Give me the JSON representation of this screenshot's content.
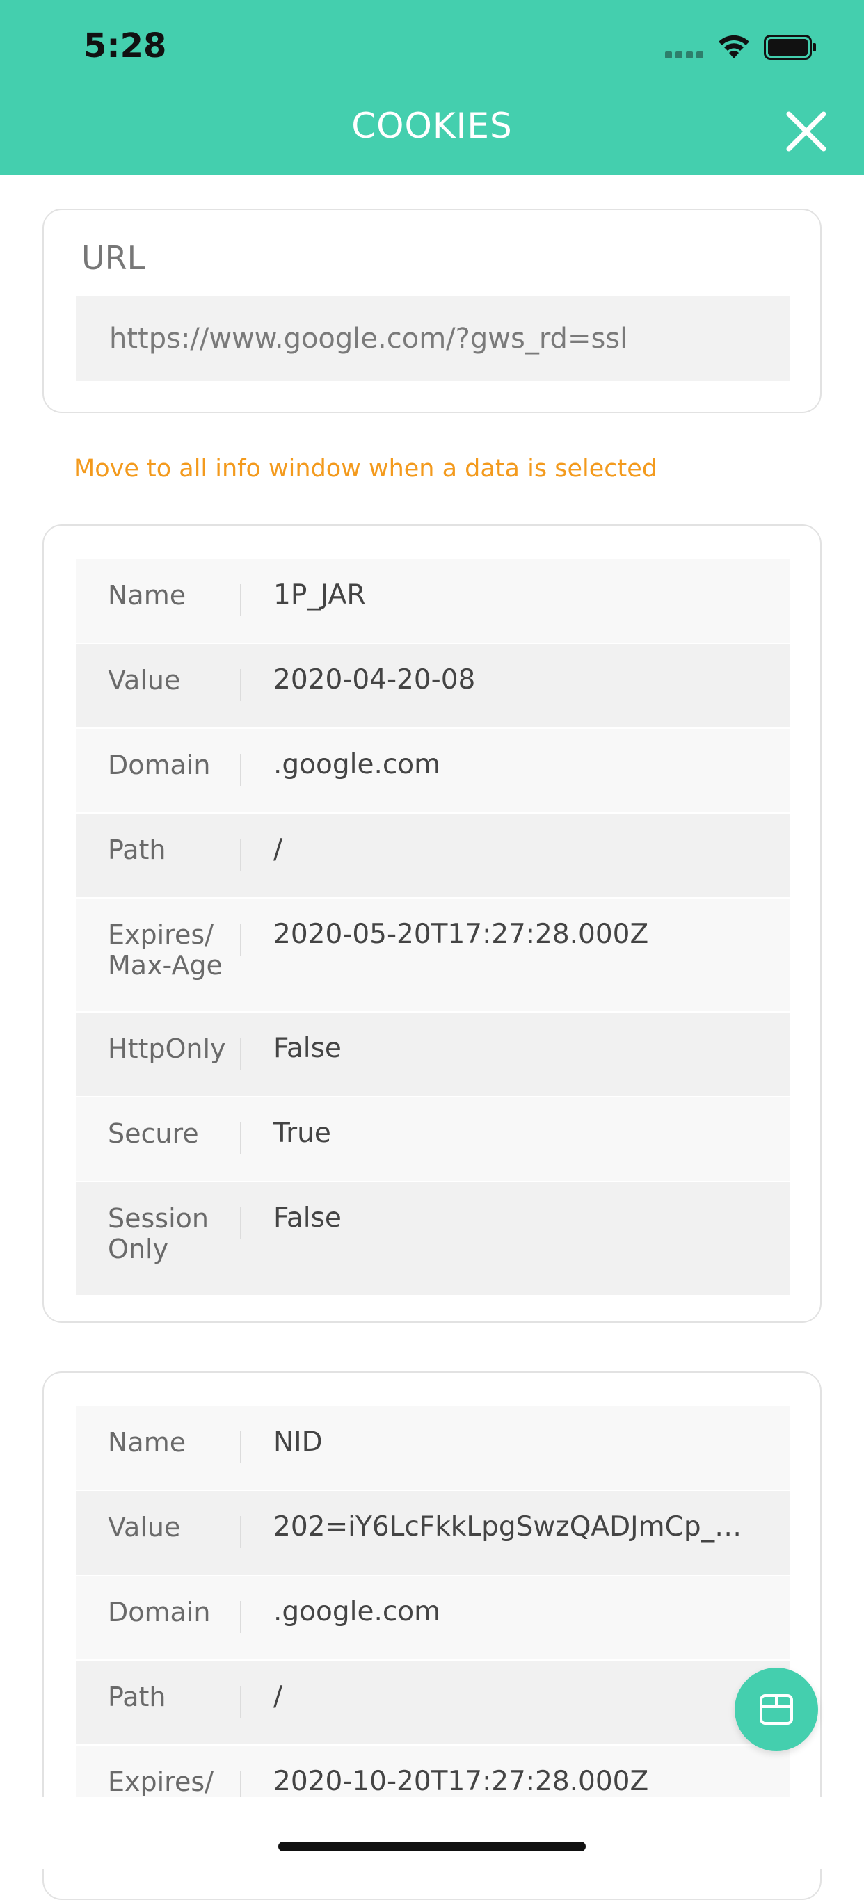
{
  "status_bar": {
    "time": "5:28"
  },
  "header": {
    "title": "COOKIES",
    "close_icon": "close-icon"
  },
  "url_section": {
    "label": "URL",
    "value": "https://www.google.com/?gws_rd=ssl"
  },
  "notice": "Move to all info window when a data is selected",
  "cookies": [
    {
      "rows": [
        {
          "key": "Name",
          "value": "1P_JAR"
        },
        {
          "key": "Value",
          "value": "2020-04-20-08"
        },
        {
          "key": "Domain",
          "value": ".google.com"
        },
        {
          "key": "Path",
          "value": "/"
        },
        {
          "key": "Expires/\nMax-Age",
          "value": "2020-05-20T17:27:28.000Z"
        },
        {
          "key": "HttpOnly",
          "value": "False"
        },
        {
          "key": "Secure",
          "value": "True"
        },
        {
          "key": "Session\nOnly",
          "value": "False"
        }
      ]
    },
    {
      "rows": [
        {
          "key": "Name",
          "value": "NID"
        },
        {
          "key": "Value",
          "value": "202=iY6LcFkkLpgSwzQADJmCp_…"
        },
        {
          "key": "Domain",
          "value": ".google.com"
        },
        {
          "key": "Path",
          "value": "/"
        },
        {
          "key": "Expires/",
          "value": "2020-10-20T17:27:28.000Z"
        }
      ]
    }
  ],
  "fab": {
    "icon": "box-icon"
  },
  "colors": {
    "accent": "#44cfae",
    "notice": "#f39a1d"
  }
}
